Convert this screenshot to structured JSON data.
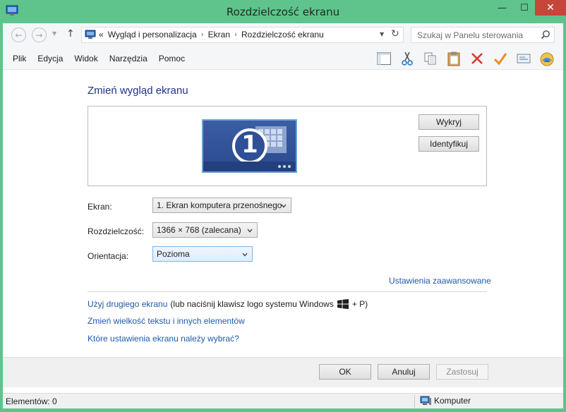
{
  "window": {
    "title": "Rozdzielczość ekranu",
    "minimize_glyph": "—",
    "maximize_glyph": "☐",
    "close_glyph": "✕"
  },
  "navigation": {
    "back_glyph": "←",
    "forward_glyph": "→",
    "dropdown_glyph": "▼",
    "up_glyph": "↑",
    "chevron": "«",
    "breadcrumb_separator": "›",
    "breadcrumbs": [
      "Wygląd i personalizacja",
      "Ekran",
      "Rozdzielczość ekranu"
    ],
    "address_dropdown_glyph": "▼",
    "refresh_glyph": "↻",
    "search_placeholder": "Szukaj w Panelu sterowania"
  },
  "menu": {
    "items": [
      "Plik",
      "Edycja",
      "Widok",
      "Narzędzia",
      "Pomoc"
    ]
  },
  "toolbar": {
    "icons": [
      "layout-icon",
      "cut-icon",
      "copy-icon",
      "paste-icon",
      "delete-icon",
      "checkmark-icon",
      "properties-icon",
      "globe-icon"
    ]
  },
  "main": {
    "heading": "Zmień wygląd ekranu",
    "monitor_number": "1",
    "detect_button": "Wykryj",
    "identify_button": "Identyfikuj",
    "display_label": "Ekran:",
    "display_value": "1. Ekran komputera przenośnego",
    "resolution_label": "Rozdzielczość:",
    "resolution_value": "1366 × 768 (zalecana)",
    "orientation_label": "Orientacja:",
    "orientation_value": "Pozioma",
    "advanced_link": "Ustawienia zaawansowane",
    "second_screen_link": "Użyj drugiego ekranu",
    "second_screen_hint": "(lub naciśnij klawisz logo systemu Windows",
    "second_screen_shortcut": "+ P)",
    "text_size_link": "Zmień wielkość tekstu i innych elementów",
    "which_settings_link": "Które ustawienia ekranu należy wybrać?"
  },
  "footer": {
    "ok_button": "OK",
    "cancel_button": "Anuluj",
    "apply_button": "Zastosuj"
  },
  "statusbar": {
    "items_count": "Elementów: 0",
    "computer_label": "Komputer"
  },
  "colors": {
    "frame": "#5ec48c",
    "link": "#1e5ba8",
    "heading": "#1e3287",
    "close_button": "#c7463a"
  }
}
